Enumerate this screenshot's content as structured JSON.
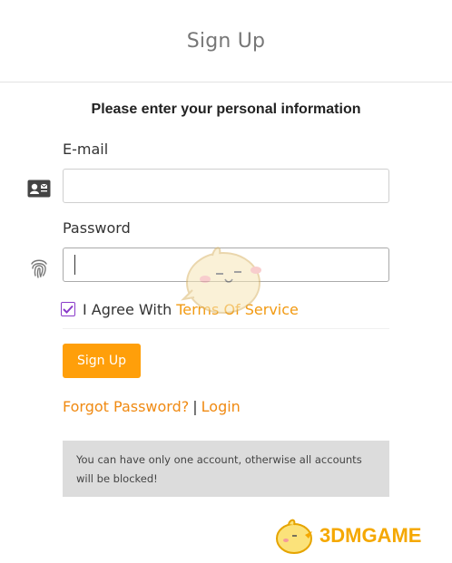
{
  "page": {
    "title": "Sign Up",
    "subtitle": "Please enter your personal information"
  },
  "form": {
    "email_label": "E-mail",
    "email_value": "",
    "password_label": "Password",
    "password_value": "",
    "agree_text": "I Agree With",
    "agree_checked": true,
    "terms_link": "Terms Of Service",
    "submit_label": "Sign Up"
  },
  "links": {
    "forgot": "Forgot Password?",
    "separator": "|",
    "login": "Login"
  },
  "notice": {
    "text": "You can have only one account, otherwise all accounts will be blocked!"
  },
  "watermark": {
    "text": "3DMGAME"
  },
  "icons": {
    "email": "contact-card-icon",
    "password": "fingerprint-icon",
    "checkbox": "checkmark-icon",
    "mascot": "chick-mascot-icon"
  },
  "colors": {
    "accent": "#ff9f0a",
    "link": "#f08a12",
    "checkbox": "#8a3bc9",
    "notice_bg": "#dcdcdc"
  }
}
